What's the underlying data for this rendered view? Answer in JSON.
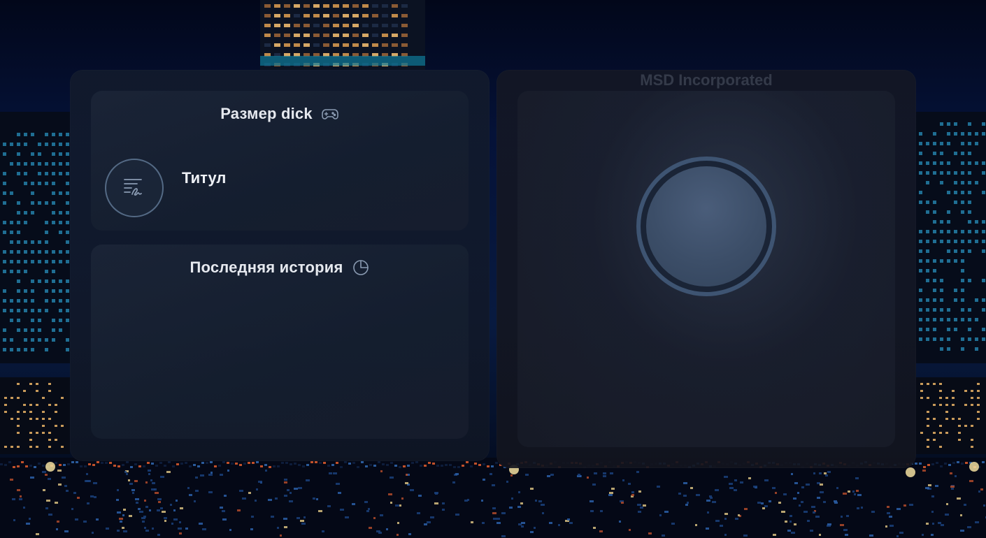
{
  "size_card": {
    "title": "Размер dick",
    "title_icon": "gamepad-icon",
    "badge_icon": "signature-list-icon",
    "badge_label": "Титул"
  },
  "history_card": {
    "title": "Последняя история",
    "title_icon": "clock-pie-icon"
  },
  "profile_panel": {
    "watermark": "MSD Incorporated",
    "avatar": "avatar-placeholder"
  },
  "colors": {
    "accent_ring": "#3e5472",
    "icon_stroke": "#8a9bb2",
    "text": "#e6e9ef"
  }
}
